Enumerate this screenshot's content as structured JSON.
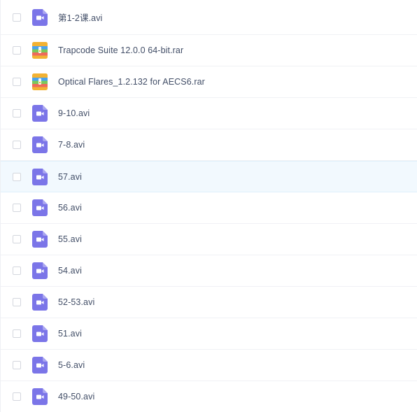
{
  "files": [
    {
      "name": "第1-2课.avi",
      "icon": "video-file-icon"
    },
    {
      "name": "Trapcode Suite 12.0.0 64-bit.rar",
      "icon": "archive-file-icon"
    },
    {
      "name": "Optical Flares_1.2.132 for AECS6.rar",
      "icon": "archive-file-icon"
    },
    {
      "name": "9-10.avi",
      "icon": "video-file-icon"
    },
    {
      "name": "7-8.avi",
      "icon": "video-file-icon"
    },
    {
      "name": "57.avi",
      "icon": "video-file-icon",
      "hovered": true
    },
    {
      "name": "56.avi",
      "icon": "video-file-icon"
    },
    {
      "name": "55.avi",
      "icon": "video-file-icon"
    },
    {
      "name": "54.avi",
      "icon": "video-file-icon"
    },
    {
      "name": "52-53.avi",
      "icon": "video-file-icon"
    },
    {
      "name": "51.avi",
      "icon": "video-file-icon"
    },
    {
      "name": "5-6.avi",
      "icon": "video-file-icon"
    },
    {
      "name": "49-50.avi",
      "icon": "video-file-icon"
    }
  ],
  "colors": {
    "video_icon": "#7b75e8",
    "archive_top": "#f2b233",
    "archive_band_blue": "#4aa3ee",
    "archive_band_green": "#7bc95a",
    "archive_band_red": "#ee6a5b",
    "hover_row": "#f2f9fe",
    "text": "#424e67"
  }
}
